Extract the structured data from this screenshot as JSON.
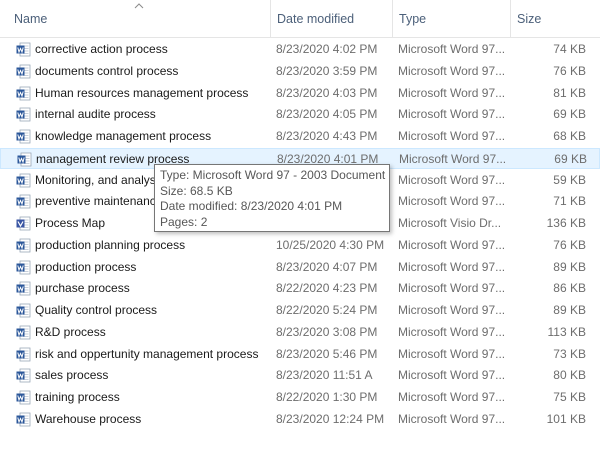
{
  "columns": {
    "name": "Name",
    "date": "Date modified",
    "type": "Type",
    "size": "Size"
  },
  "files": [
    {
      "name": "corrective action process",
      "date": "8/23/2020 4:02 PM",
      "type": "Microsoft Word 97...",
      "size": "74 KB",
      "icon": "word-icon"
    },
    {
      "name": "documents control process",
      "date": "8/23/2020 3:59 PM",
      "type": "Microsoft Word 97...",
      "size": "76 KB",
      "icon": "word-icon"
    },
    {
      "name": "Human resources management process",
      "date": "8/23/2020 4:03 PM",
      "type": "Microsoft Word 97...",
      "size": "81 KB",
      "icon": "word-icon"
    },
    {
      "name": "internal audite process",
      "date": "8/23/2020 4:05 PM",
      "type": "Microsoft Word 97...",
      "size": "69 KB",
      "icon": "word-icon"
    },
    {
      "name": "knowledge management process",
      "date": "8/23/2020 4:43 PM",
      "type": "Microsoft Word 97...",
      "size": "68 KB",
      "icon": "word-icon"
    },
    {
      "name": "management review process",
      "date": "8/23/2020 4:01 PM",
      "type": "Microsoft Word 97...",
      "size": "69 KB",
      "icon": "word-icon",
      "hover": true
    },
    {
      "name": "Monitoring, and analysis process",
      "date": "",
      "type": "Microsoft Word 97...",
      "size": "59 KB",
      "icon": "word-icon"
    },
    {
      "name": "preventive maintenance process",
      "date": "",
      "type": "Microsoft Word 97...",
      "size": "71 KB",
      "icon": "word-icon"
    },
    {
      "name": "Process Map",
      "date": "",
      "type": "Microsoft Visio Dr...",
      "size": "136 KB",
      "icon": "visio-icon"
    },
    {
      "name": "production planning process",
      "date": "10/25/2020 4:30 PM",
      "type": "Microsoft Word 97...",
      "size": "76 KB",
      "icon": "word-icon"
    },
    {
      "name": "production process",
      "date": "8/23/2020 4:07 PM",
      "type": "Microsoft Word 97...",
      "size": "89 KB",
      "icon": "word-icon"
    },
    {
      "name": "purchase process",
      "date": "8/22/2020 4:23 PM",
      "type": "Microsoft Word 97...",
      "size": "86 KB",
      "icon": "word-icon"
    },
    {
      "name": "Quality control process",
      "date": "8/22/2020 5:24 PM",
      "type": "Microsoft Word 97...",
      "size": "89 KB",
      "icon": "word-icon"
    },
    {
      "name": "R&D process",
      "date": "8/23/2020 3:08 PM",
      "type": "Microsoft Word 97...",
      "size": "113 KB",
      "icon": "word-icon"
    },
    {
      "name": "risk and oppertunity management process",
      "date": "8/23/2020 5:46 PM",
      "type": "Microsoft Word 97...",
      "size": "73 KB",
      "icon": "word-icon"
    },
    {
      "name": "sales process",
      "date": "8/23/2020 11:51 A",
      "type": "Microsoft Word 97...",
      "size": "80 KB",
      "icon": "word-icon"
    },
    {
      "name": "training process",
      "date": "8/22/2020 1:30 PM",
      "type": "Microsoft Word 97...",
      "size": "75 KB",
      "icon": "word-icon"
    },
    {
      "name": "Warehouse process",
      "date": "8/23/2020 12:24 PM",
      "type": "Microsoft Word 97...",
      "size": "101 KB",
      "icon": "word-icon"
    }
  ],
  "tooltip": {
    "type": "Type: Microsoft Word 97 - 2003 Document",
    "size": "Size: 68.5 KB",
    "date": "Date modified: 8/23/2020 4:01 PM",
    "pages": "Pages: 2"
  },
  "colors": {
    "header_text": "#4c607a",
    "hover_bg": "#e5f3ff",
    "word_blue": "#2b579a",
    "visio_blue": "#3955a3"
  }
}
